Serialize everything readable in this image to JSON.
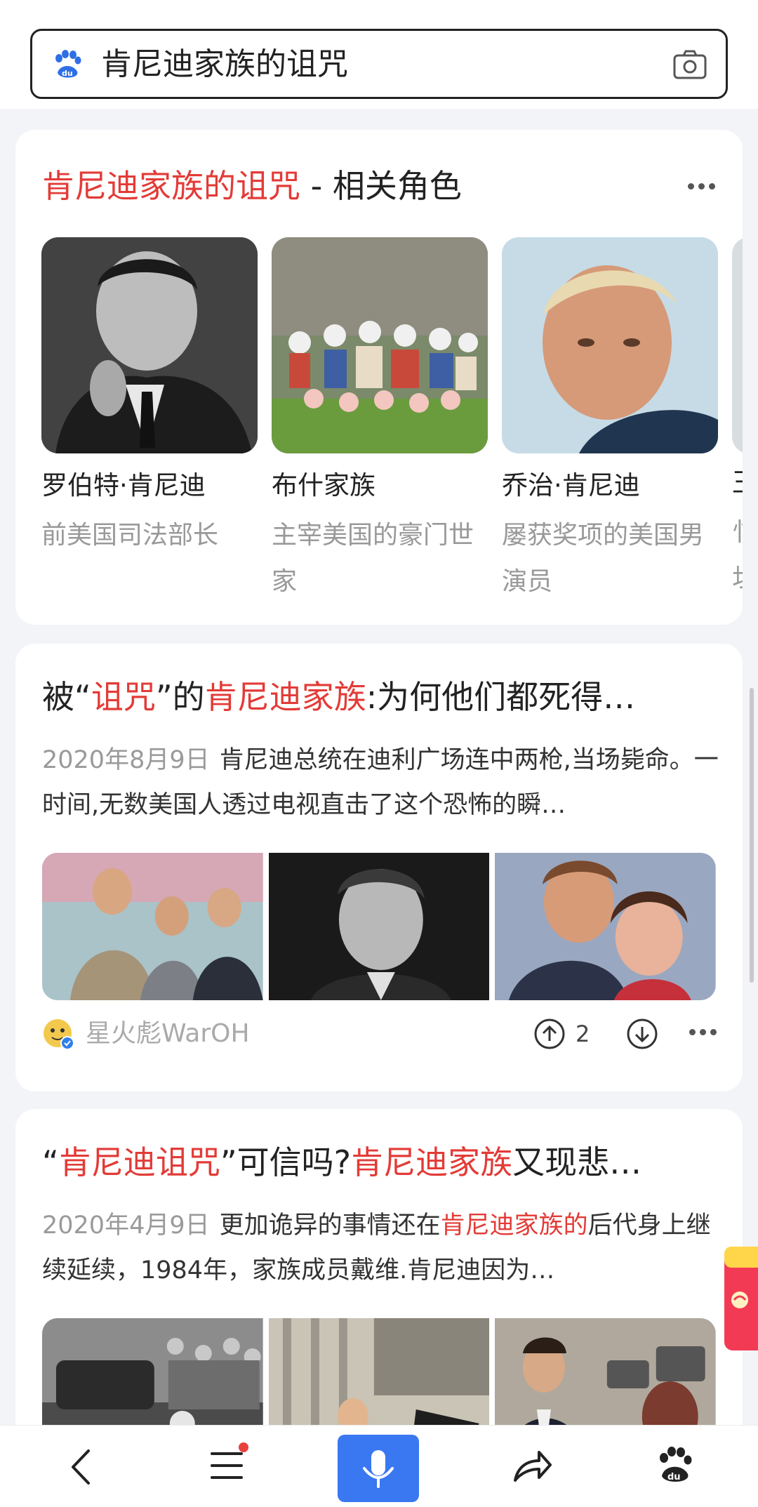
{
  "search": {
    "query": "肯尼迪家族的诅咒",
    "logo_icon": "baidu-paw-icon",
    "camera_icon": "camera-icon"
  },
  "related_roles": {
    "title_highlight": "肯尼迪家族的诅咒",
    "title_rest": " - 相关角色",
    "items": [
      {
        "name": "罗伯特·肯尼迪",
        "desc": "前美国司法部长"
      },
      {
        "name": "布什家族",
        "desc": "主宰美国的豪门世家"
      },
      {
        "name": "乔治·肯尼迪",
        "desc": "屡获奖项的美国男演员"
      },
      {
        "name": "王",
        "desc": "忄\n圵"
      }
    ]
  },
  "article1": {
    "title_parts": [
      "被“",
      "诅咒",
      "”的",
      "肯尼迪家族",
      ":为何他们都死得…"
    ],
    "date": "2020年8月9日",
    "snippet": "肯尼迪总统在迪利广场连中两枪,当场毙命。一时间,无数美国人透过电视直击了这个恐怖的瞬…",
    "author": "星火彪WarOH",
    "upvotes": "2"
  },
  "article2": {
    "title_parts": [
      "“",
      "肯尼迪诅咒",
      "”可信吗?",
      "肯尼迪家族",
      "又现悲…"
    ],
    "date": "2020年4月9日",
    "snippet_parts": [
      "更加诡异的事情还在",
      "肯尼迪家族的",
      "后代身上继续延续，1984年，家族成员戴维.肯尼迪因为…"
    ]
  },
  "colors": {
    "highlight": "#e33b37",
    "mic_button": "#3a78f2",
    "brand_blue": "#2f6fe6"
  },
  "nav_icons": [
    "back-arrow-icon",
    "menu-icon",
    "microphone-icon",
    "share-icon",
    "baidu-du-icon"
  ]
}
